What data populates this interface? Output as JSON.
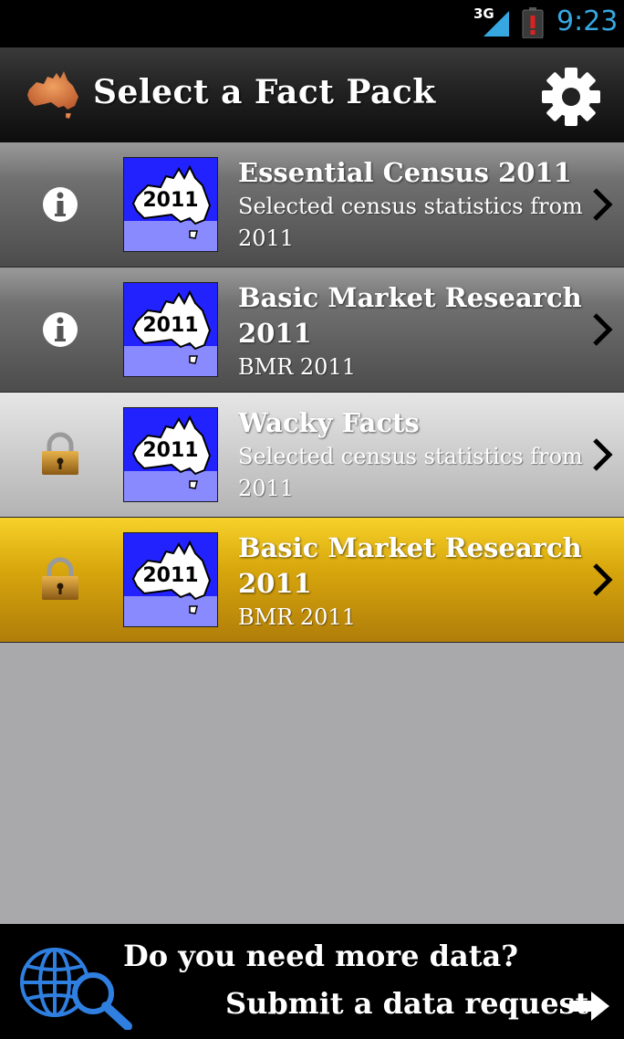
{
  "status_bar": {
    "network": "3G",
    "time": "9:23",
    "icons": [
      "signal-icon",
      "battery-alert-icon"
    ]
  },
  "header": {
    "title": "Select a Fact Pack",
    "logo_icon": "australia-map-icon",
    "settings_icon": "gear-icon"
  },
  "packs": [
    {
      "title": "Essential Census 2011",
      "subtitle": "Selected census statistics from 2011",
      "thumb_label": "2011",
      "status_icon": "info-icon",
      "style": "dark"
    },
    {
      "title": "Basic Market Research 2011",
      "subtitle": "BMR 2011",
      "thumb_label": "2011",
      "status_icon": "info-icon",
      "style": "dark"
    },
    {
      "title": "Wacky Facts",
      "subtitle": "Selected census statistics from 2011",
      "thumb_label": "2011",
      "status_icon": "lock-icon",
      "style": "light"
    },
    {
      "title": "Basic Market Research 2011",
      "subtitle": "BMR 2011",
      "thumb_label": "2011",
      "status_icon": "lock-icon",
      "style": "gold"
    }
  ],
  "footer": {
    "line1": "Do you need more data?",
    "line2": "Submit a data request",
    "icon": "globe-search-icon",
    "arrow_icon": "arrow-right-icon"
  },
  "colors": {
    "status_time": "#36a7e0",
    "thumb_blue": "#2222ff",
    "thumb_light_blue": "#8a8aff",
    "highlight_gold": "#d9a80d",
    "background": "#a9a8aa"
  }
}
